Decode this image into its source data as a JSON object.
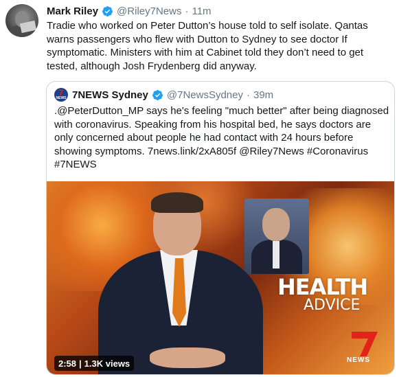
{
  "tweet": {
    "author_name": "Mark Riley",
    "author_handle": "@Riley7News",
    "separator": "·",
    "time": "11m",
    "text": "Tradie who worked on Peter Dutton’s house told to self isolate. Qantas warns passengers who flew with Dutton to Sydney to see doctor If symptomatic. Ministers with him at Cabinet told they don’t need to get tested, although Josh Frydenberg did anyway."
  },
  "quoted": {
    "author_name": "7NEWS Sydney",
    "author_handle": "@7NewsSydney",
    "separator": "·",
    "time": "39m",
    "avatar_text_top": "7",
    "avatar_text_bottom": "NEWS",
    "text": ".@PeterDutton_MP says he's feeling \"much better\" after being diagnosed with coronavirus. Speaking from his hospital bed, he says doctors are only concerned about people he had contact with 24 hours before showing symptoms. 7news.link/2xA805f @Riley7News #Coronavirus #7NEWS",
    "video": {
      "overlay_title": "HEALTH",
      "overlay_subtitle": "ADVICE",
      "logo_number": "7",
      "logo_word": "NEWS",
      "duration": "2:58",
      "views": "1.3K views"
    }
  },
  "colors": {
    "verified_blue": "#1da1f2",
    "secondary_text": "#657786",
    "border": "#ccd6dd"
  },
  "icons": {
    "verified": "verified-badge-icon"
  }
}
